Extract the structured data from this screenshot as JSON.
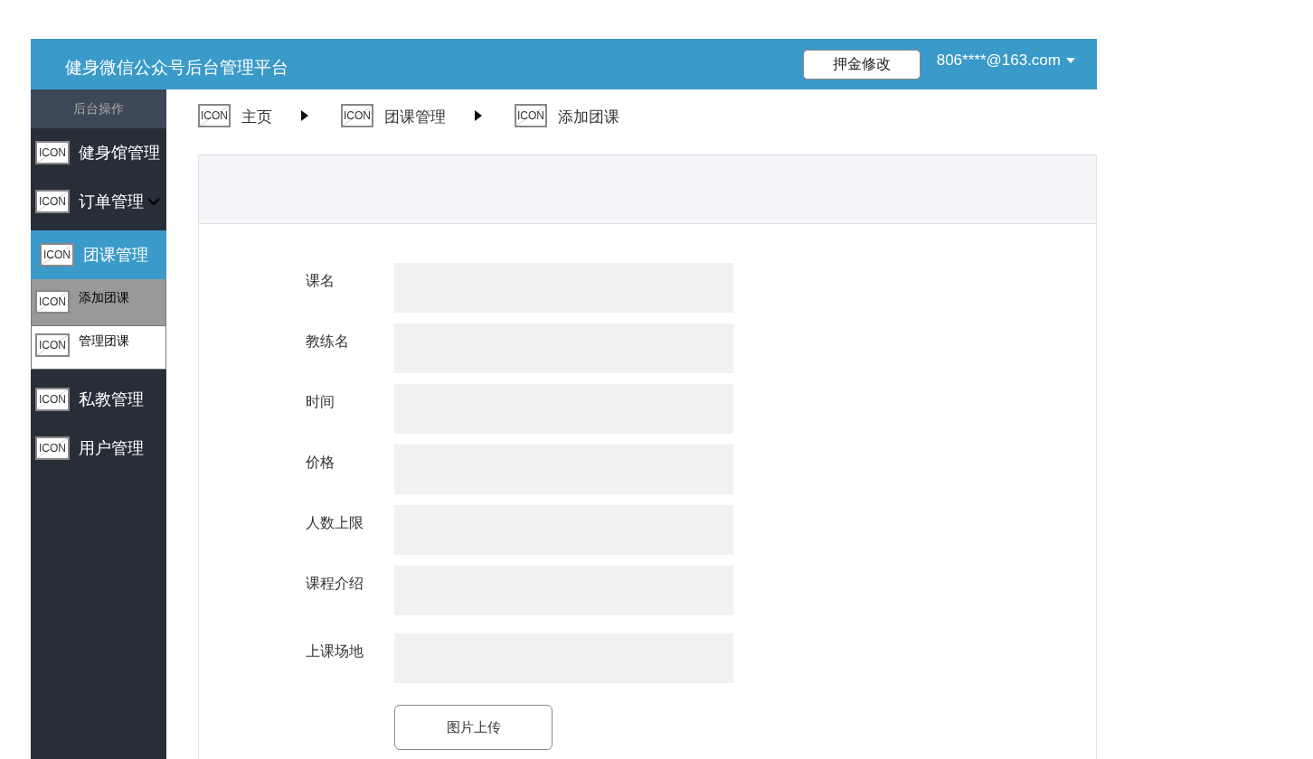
{
  "header": {
    "title": "健身微信公众号后台管理平台",
    "deposit_button": "押金修改",
    "account": "806****@163.com"
  },
  "sidebar": {
    "heading": "后台操作",
    "items": [
      {
        "label": "健身馆管理",
        "icon": "ICON",
        "selected": false,
        "dropdown": false
      },
      {
        "label": "订单管理",
        "icon": "ICON",
        "selected": false,
        "dropdown": true
      },
      {
        "label": "团课管理",
        "icon": "ICON",
        "selected": true,
        "dropdown": false,
        "children": [
          {
            "label": "添加团课",
            "icon": "ICON",
            "selected": true
          },
          {
            "label": "管理团课",
            "icon": "ICON",
            "selected": false
          }
        ]
      },
      {
        "label": "私教管理",
        "icon": "ICON",
        "selected": false,
        "dropdown": false
      },
      {
        "label": "用户管理",
        "icon": "ICON",
        "selected": false,
        "dropdown": false
      }
    ]
  },
  "breadcrumb": [
    {
      "label": "主页",
      "icon": "ICON"
    },
    {
      "label": "团课管理",
      "icon": "ICON"
    },
    {
      "label": "添加团课",
      "icon": "ICON"
    }
  ],
  "form": {
    "fields": [
      {
        "label": "课名"
      },
      {
        "label": "教练名"
      },
      {
        "label": "时间"
      },
      {
        "label": "价格"
      },
      {
        "label": "人数上限"
      },
      {
        "label": "课程介绍"
      },
      {
        "label": "上课场地"
      }
    ],
    "upload_button": "图片上传"
  }
}
